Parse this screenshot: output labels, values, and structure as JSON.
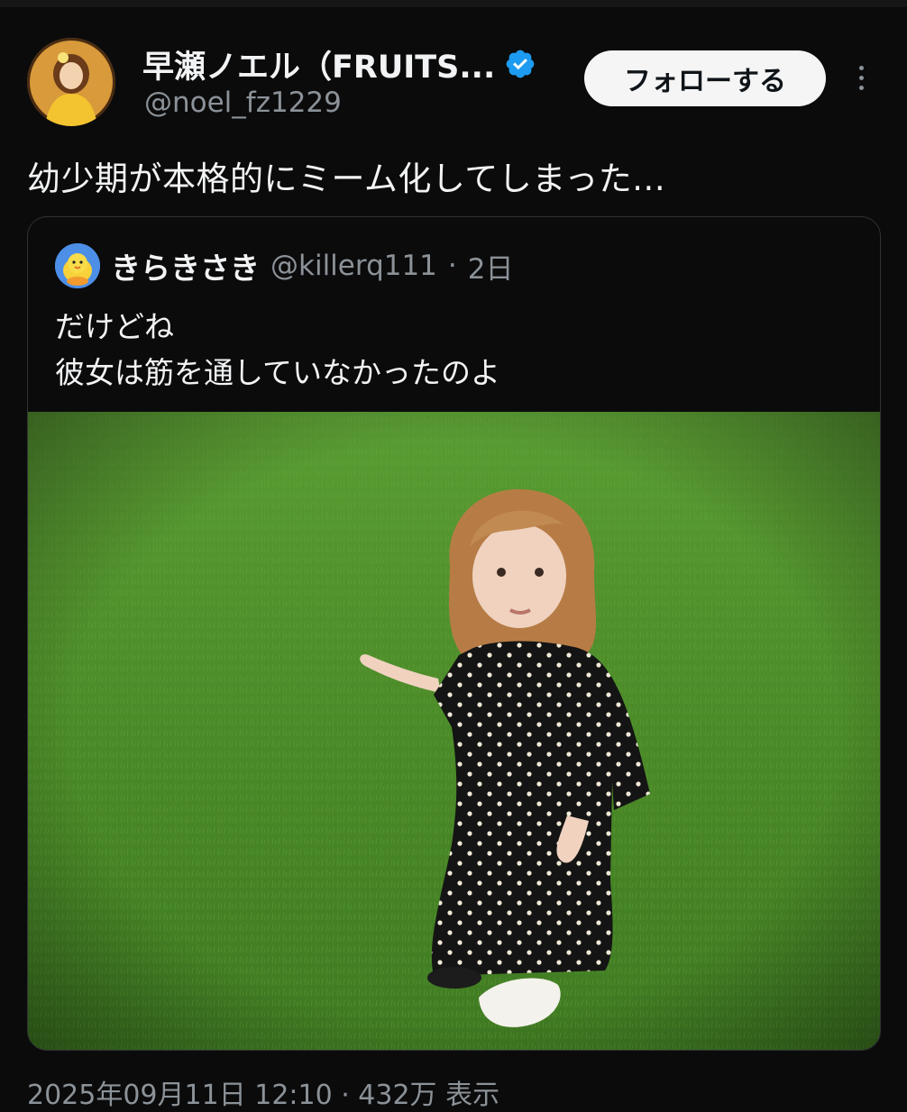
{
  "post": {
    "author": {
      "display_name": "早瀬ノエル（FRUITS...",
      "handle": "@noel_fz1229",
      "verified": true
    },
    "follow_label": "フォローする",
    "more_icon": "more-vertical-icon",
    "text": "幼少期が本格的にミーム化してしまった...",
    "quote": {
      "author_name": "きらきさき",
      "handle": "@killerq111",
      "separator": "·",
      "time": "2日",
      "lines": [
        "だけどね",
        "彼女は筋を通していなかったのよ"
      ]
    },
    "meta": "2025年09月11日 12:10 · 432万 表示"
  },
  "colors": {
    "background": "#0b0b0c",
    "text_primary": "#f2f3f4",
    "text_secondary": "#8b9298",
    "verified": "#1d9bf0",
    "follow_button_bg": "#f5f5f5",
    "grass": "#4f8f2a"
  }
}
